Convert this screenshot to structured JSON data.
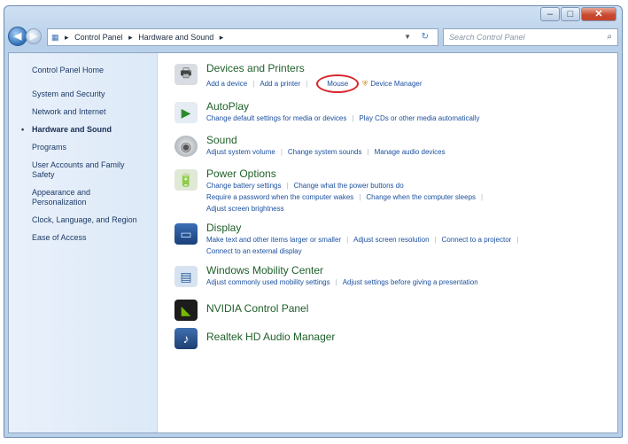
{
  "window": {
    "buttons": {
      "minimize": "–",
      "maximize": "□",
      "close": "✕"
    }
  },
  "address": {
    "crumbs": [
      "Control Panel",
      "Hardware and Sound"
    ],
    "search_placeholder": "Search Control Panel"
  },
  "sidebar": {
    "home": "Control Panel Home",
    "items": [
      "System and Security",
      "Network and Internet",
      "Hardware and Sound",
      "Programs",
      "User Accounts and Family Safety",
      "Appearance and Personalization",
      "Clock, Language, and Region",
      "Ease of Access"
    ]
  },
  "categories": [
    {
      "title": "Devices and Printers",
      "links": [
        "Add a device",
        "Add a printer",
        "Mouse",
        "Device Manager"
      ]
    },
    {
      "title": "AutoPlay",
      "links": [
        "Change default settings for media or devices",
        "Play CDs or other media automatically"
      ]
    },
    {
      "title": "Sound",
      "links": [
        "Adjust system volume",
        "Change system sounds",
        "Manage audio devices"
      ]
    },
    {
      "title": "Power Options",
      "links": [
        "Change battery settings",
        "Change what the power buttons do",
        "Require a password when the computer wakes",
        "Change when the computer sleeps",
        "Adjust screen brightness"
      ]
    },
    {
      "title": "Display",
      "links": [
        "Make text and other items larger or smaller",
        "Adjust screen resolution",
        "Connect to a projector",
        "Connect to an external display"
      ]
    },
    {
      "title": "Windows Mobility Center",
      "links": [
        "Adjust commonly used mobility settings",
        "Adjust settings before giving a presentation"
      ]
    },
    {
      "title": "NVIDIA Control Panel",
      "links": []
    },
    {
      "title": "Realtek HD Audio Manager",
      "links": []
    }
  ],
  "colors": {
    "accent": "#1a4f9f",
    "category_title": "#1f5f2a",
    "highlight_circle": "#d8232a"
  }
}
